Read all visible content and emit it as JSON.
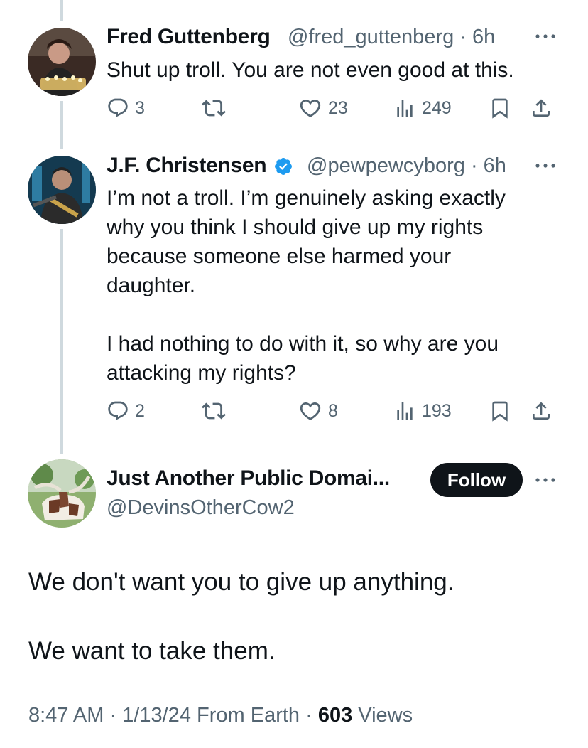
{
  "thread": [
    {
      "name": "Fred Guttenberg",
      "handle": "@fred_guttenberg",
      "time": "6h",
      "text": "Shut up troll.  You are not even good at this.",
      "replies": "3",
      "reposts": "",
      "likes": "23",
      "views": "249",
      "verified": false
    },
    {
      "name": "J.F. Christensen",
      "handle": "@pewpewcyborg",
      "time": "6h",
      "text": "I’m not a troll. I’m genuinely asking exactly\nwhy you think I should give up my rights\nbecause someone else harmed your\ndaughter.\n\nI had nothing to do with it, so why are you\nattacking my rights?",
      "replies": "2",
      "reposts": "",
      "likes": "8",
      "views": "193",
      "verified": true
    }
  ],
  "main_post": {
    "name": "Just Another Public Domai...",
    "handle": "@DevinsOtherCow2",
    "follow_label": "Follow",
    "line1": "We don't want you to give up anything.",
    "line2": "We want to take them.",
    "time": "8:47 AM",
    "date": "1/13/24",
    "source": "From Earth",
    "views_count": "603",
    "views_label": "Views"
  },
  "colors": {
    "text": "#0f1419",
    "secondary": "#536471",
    "thread_line": "#cfd9de",
    "verified": "#1d9bf0",
    "follow_bg": "#0f1419"
  },
  "icons": [
    "reply-icon",
    "repost-icon",
    "like-icon",
    "views-icon",
    "bookmark-icon",
    "share-icon",
    "more-icon",
    "verified-badge-icon"
  ]
}
